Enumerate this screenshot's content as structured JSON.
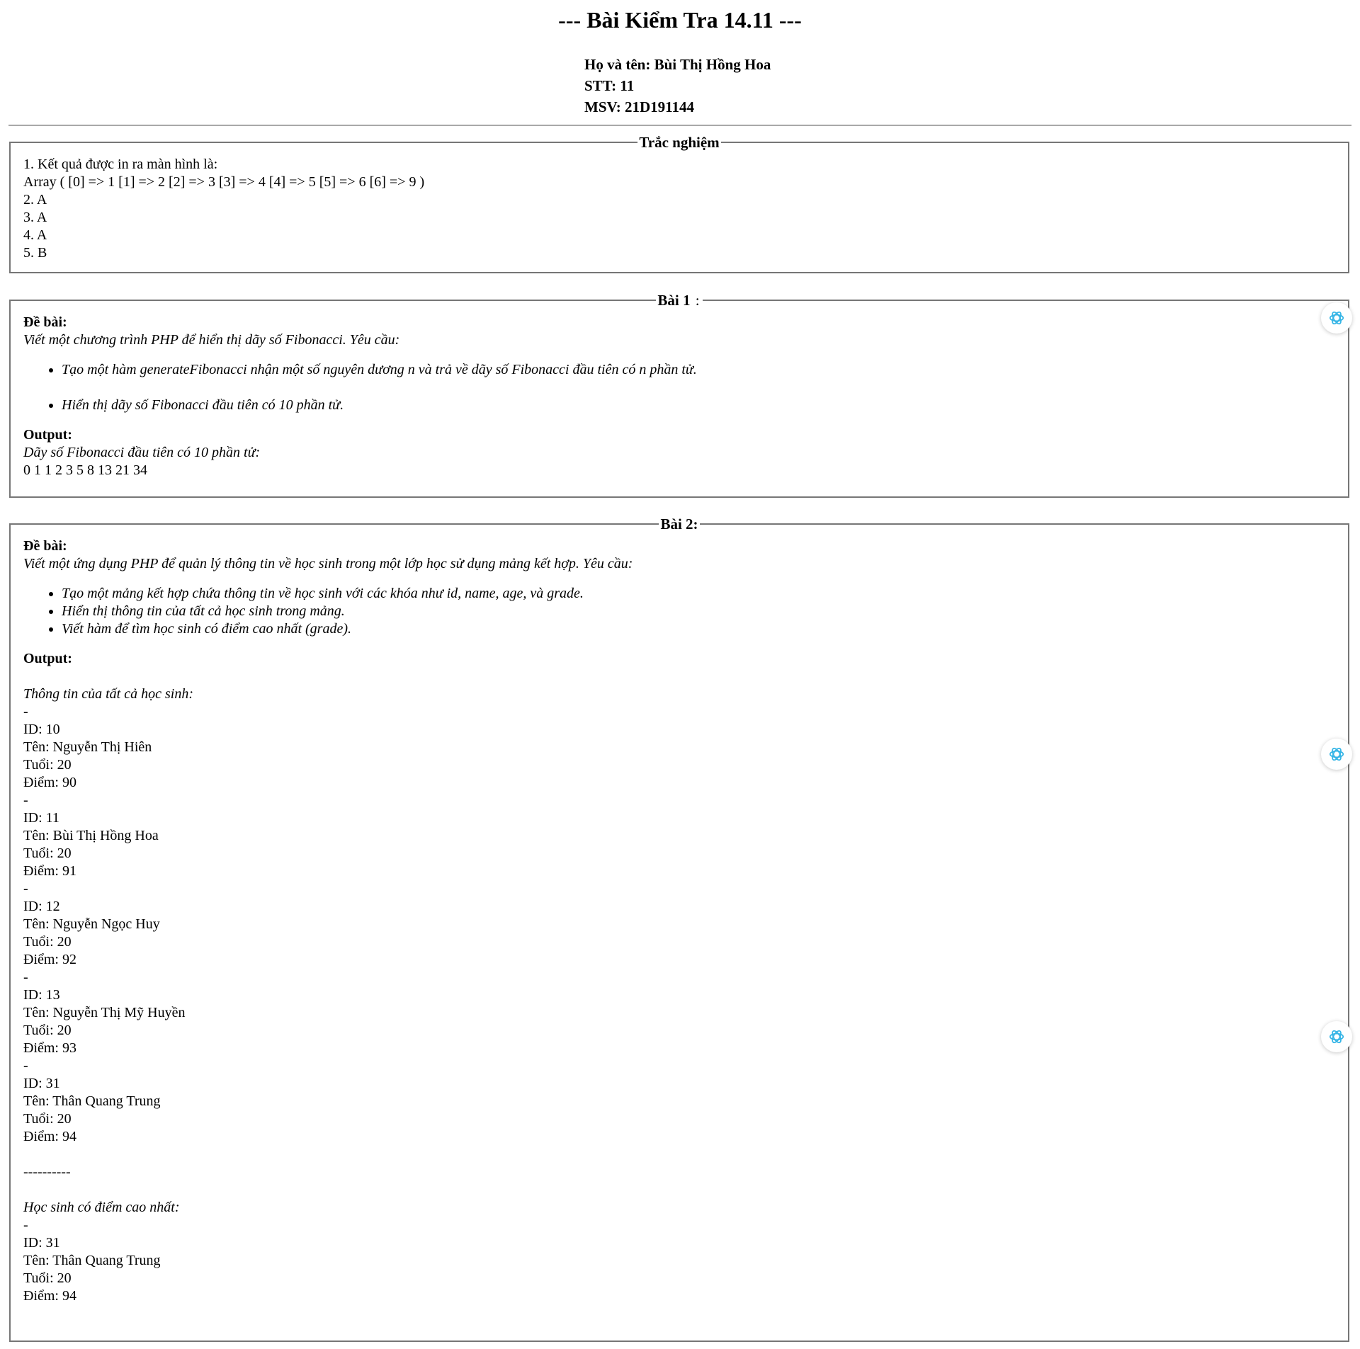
{
  "header": {
    "title": "--- Bài Kiểm Tra 14.11 ---",
    "name_line": "Họ và tên: Bùi Thị Hồng Hoa",
    "stt_line": "STT: 11",
    "msv_line": "MSV: 21D191144"
  },
  "quiz": {
    "legend": "Trắc nghiệm",
    "lines": [
      "1. Kết quả được in ra màn hình là:",
      "Array ( [0] => 1 [1] => 2 [2] => 3 [3] => 4 [4] => 5 [5] => 6 [6] => 9 )",
      "2. A",
      "3. A",
      "4. A",
      "5. B"
    ]
  },
  "bai1": {
    "legend_bold": "Bài 1",
    "legend_rest": " :",
    "de_bai_label": "Đề bài:",
    "intro": "Viết một chương trình PHP để hiển thị dãy số Fibonacci. Yêu cầu:",
    "items": [
      "Tạo một hàm generateFibonacci nhận một số nguyên dương n và trả về dãy số Fibonacci đầu tiên có n phần tử.",
      "Hiển thị dãy số Fibonacci đầu tiên có 10 phần tử."
    ],
    "output_label": "Output:",
    "output_caption": "Dãy số Fibonacci đầu tiên có 10 phần tử:",
    "output_value": "0 1 1 2 3 5 8 13 21 34"
  },
  "bai2": {
    "legend": "Bài 2:",
    "de_bai_label": "Đề bài:",
    "intro": "Viết một ứng dụng PHP để quản lý thông tin về học sinh trong một lớp học sử dụng mảng kết hợp. Yêu cầu:",
    "items": [
      "Tạo một mảng kết hợp chứa thông tin về học sinh với các khóa như id, name, age, và grade.",
      "Hiển thị thông tin của tất cả học sinh trong mảng.",
      "Viết hàm để tìm học sinh có điểm cao nhất (grade)."
    ],
    "output_label": "Output:",
    "all_caption": "Thông tin của tất cả học sinh:",
    "students": [
      {
        "sep": "-",
        "id": "ID: 10",
        "name": "Tên: Nguyễn Thị Hiên",
        "age": "Tuổi: 20",
        "grade": "Điểm: 90"
      },
      {
        "sep": "-",
        "id": "ID: 11",
        "name": "Tên: Bùi Thị Hồng Hoa",
        "age": "Tuổi: 20",
        "grade": "Điểm: 91"
      },
      {
        "sep": "-",
        "id": "ID: 12",
        "name": "Tên: Nguyễn Ngọc Huy",
        "age": "Tuổi: 20",
        "grade": "Điểm: 92"
      },
      {
        "sep": "-",
        "id": "ID: 13",
        "name": "Tên: Nguyễn Thị Mỹ Huyền",
        "age": "Tuổi: 20",
        "grade": "Điểm: 93"
      },
      {
        "sep": "-",
        "id": "ID: 31",
        "name": "Tên: Thân Quang Trung",
        "age": "Tuổi: 20",
        "grade": "Điểm: 94"
      }
    ],
    "divider_text": "----------",
    "top_caption": "Học sinh có điểm cao nhất:",
    "top_student": {
      "sep": "-",
      "id": "ID: 31",
      "name": "Tên: Thân Quang Trung",
      "age": "Tuổi: 20",
      "grade": "Điểm: 94"
    }
  },
  "floating_buttons": [
    {
      "icon": "chatgpt-icon"
    },
    {
      "icon": "chatgpt-icon"
    },
    {
      "icon": "chatgpt-icon"
    }
  ],
  "colors": {
    "text": "#000000",
    "fieldset_border": "#767676",
    "hr": "#a9a9a9",
    "icon_accent": "#35b5e6"
  }
}
